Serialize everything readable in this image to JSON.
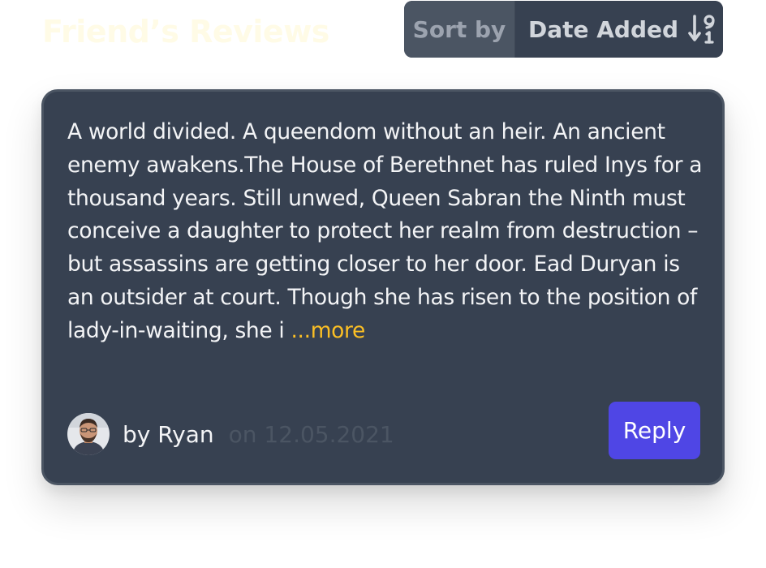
{
  "section": {
    "heading": "Friend’s Reviews"
  },
  "sort": {
    "label": "Sort by",
    "value": "Date Added",
    "icon": "sort-numeric-descending-icon"
  },
  "review": {
    "text": "A world divided. A queendom without an heir. An ancient enemy awakens.The House of Berethnet has ruled Inys for a thousand years. Still unwed, Queen Sabran the Ninth must conceive a daughter to protect her realm from destruction – but assassins are getting closer to her door. Ead Duryan is an outsider at court. Though she has risen to the position of lady-in-waiting, she i ",
    "more_label": "...more",
    "author": "by Ryan",
    "date": "on 12.05.2021",
    "reply_label": "Reply"
  },
  "colors": {
    "card_background": "#374151",
    "accent": "#4f46e5",
    "more_link": "#fbbf24"
  }
}
